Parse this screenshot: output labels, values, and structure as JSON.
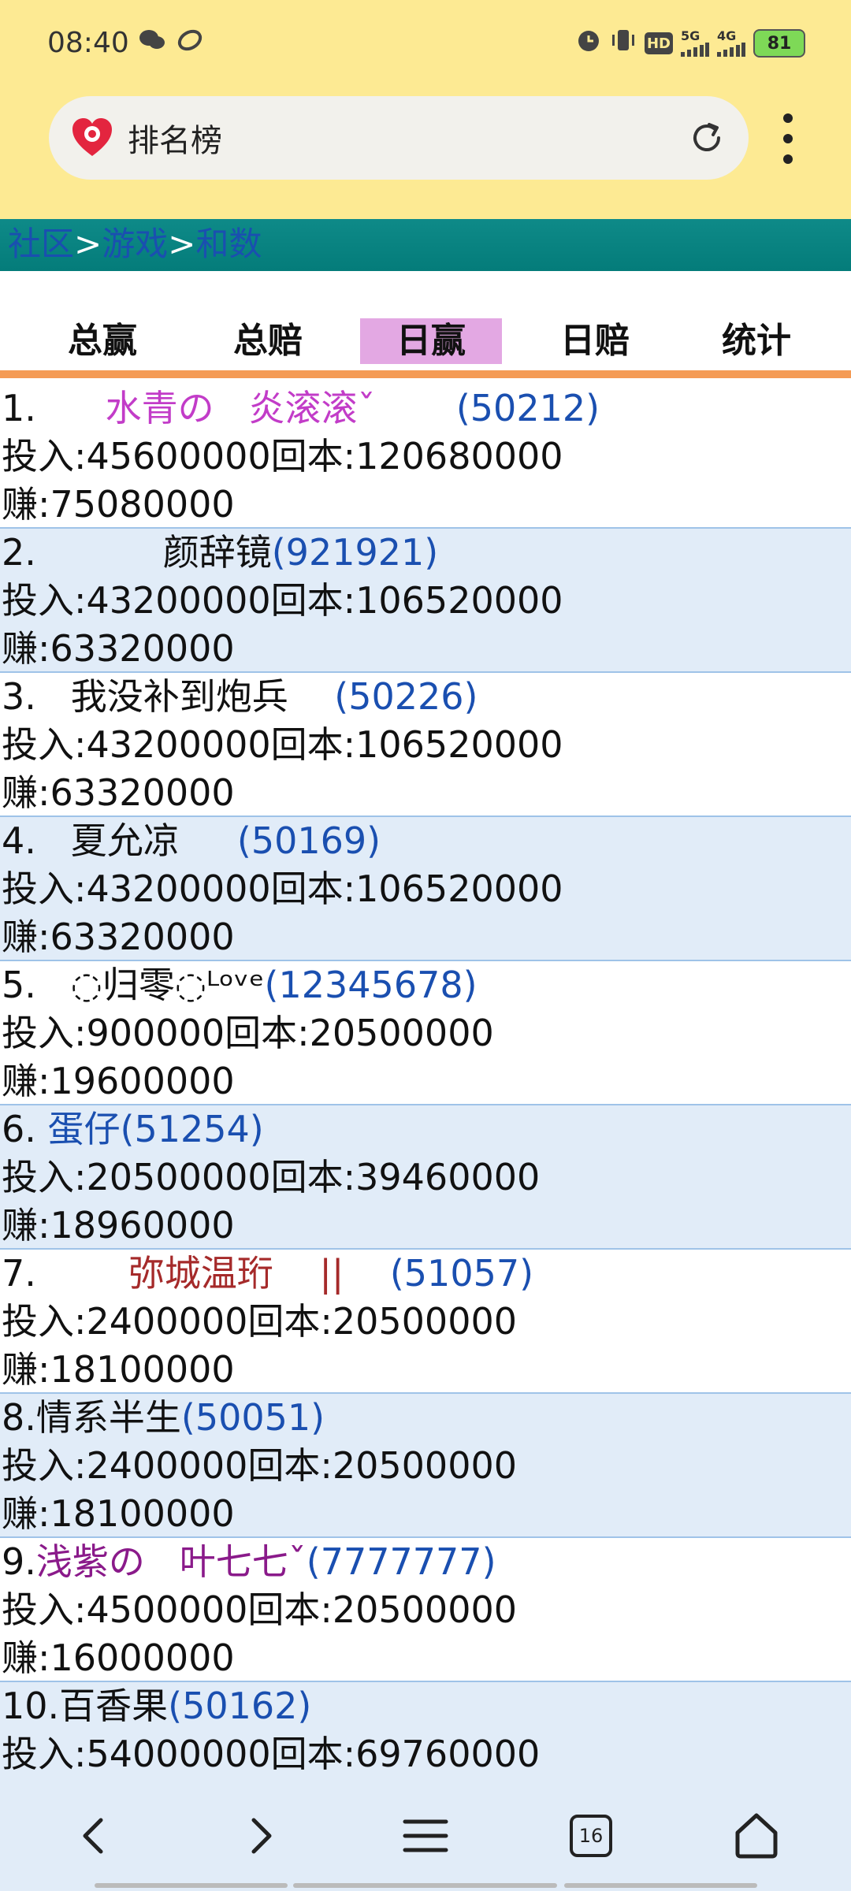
{
  "status_bar": {
    "time": "08:40",
    "battery": "81",
    "left_icons": [
      "chat-icon",
      "leaf-icon"
    ],
    "right_icons": [
      "alarm-icon",
      "vibrate-icon",
      "hd-icon",
      "signal-5g-icon",
      "signal-4g-icon"
    ],
    "hd_label": "HD",
    "net_5g": "5G",
    "net_4g": "4G"
  },
  "browser": {
    "url_title": "排名榜"
  },
  "breadcrumb": {
    "items": [
      "社区",
      "游戏",
      "和数"
    ],
    "separator": ">"
  },
  "tabs": [
    {
      "label": "总赢",
      "active": false
    },
    {
      "label": "总赔",
      "active": false
    },
    {
      "label": "日赢",
      "active": true
    },
    {
      "label": "日赔",
      "active": false
    },
    {
      "label": "统计",
      "active": false
    }
  ],
  "entries": [
    {
      "rank": "1.",
      "name": "      水青の   炎滚滚ˇ       ",
      "name_color": "#c23cc8",
      "id": "(50212)",
      "line2": "投入:45600000回本:120680000",
      "line3": "赚:75080000"
    },
    {
      "rank": "2.",
      "name": "           颜辞镜",
      "name_color": "#111111",
      "id": "(921921)",
      "line2": "投入:43200000回本:106520000",
      "line3": "赚:63320000"
    },
    {
      "rank": "3.",
      "name": "   我没补到炮兵    ",
      "name_color": "#111111",
      "id": "(50226)",
      "line2": "投入:43200000回本:106520000",
      "line3": "赚:63320000"
    },
    {
      "rank": "4.",
      "name": "   夏允凉     ",
      "name_color": "#111111",
      "id": "(50169)",
      "line2": "投入:43200000回本:106520000",
      "line3": "赚:63320000"
    },
    {
      "rank": "5.",
      "name": "   ◌归零◌ᴸᵒᵛᵉ",
      "name_color": "#111111",
      "id": "(12345678)",
      "line2": "投入:900000回本:20500000",
      "line3": "赚:19600000"
    },
    {
      "rank": "6.",
      "name": " 蛋仔",
      "name_color": "#1a4fb0",
      "id": "(51254)",
      "line2": "投入:20500000回本:39460000",
      "line3": "赚:18960000"
    },
    {
      "rank": "7.",
      "name": "        弥城温珩    ||    ",
      "name_color": "#a52a2a",
      "id": "(51057)",
      "line2": "投入:2400000回本:20500000",
      "line3": "赚:18100000"
    },
    {
      "rank": "8.",
      "name": "情系半生",
      "name_color": "#111111",
      "id": "(50051)",
      "line2": "投入:2400000回本:20500000",
      "line3": "赚:18100000"
    },
    {
      "rank": "9.",
      "name": "浅紫の   叶七七ˇ",
      "name_color": "#8a1a8a",
      "id": "(7777777)",
      "line2": "投入:4500000回本:20500000",
      "line3": "赚:16000000"
    },
    {
      "rank": "10.",
      "name": "百香果",
      "name_color": "#111111",
      "id": "(50162)",
      "line2": "投入:54000000回本:69760000",
      "line3": ""
    }
  ],
  "bottom_nav": {
    "tab_count": "16",
    "icons": [
      "back-icon",
      "forward-icon",
      "menu-icon",
      "tabs-icon",
      "home-icon"
    ]
  }
}
